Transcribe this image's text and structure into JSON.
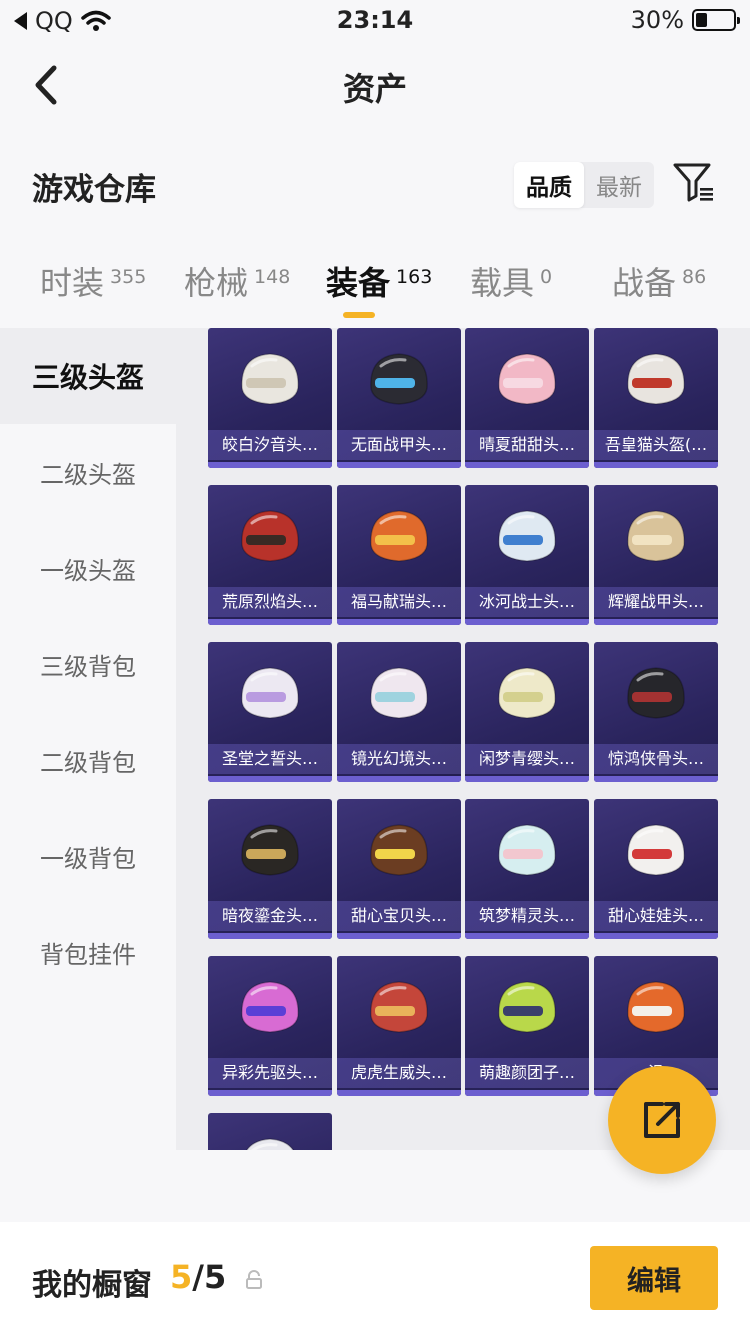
{
  "status_bar": {
    "carrier": "QQ",
    "time": "23:14",
    "battery": "30%",
    "battery_level": 0.3
  },
  "nav": {
    "title": "资产"
  },
  "header": {
    "title": "游戏仓库",
    "sort_options": [
      "品质",
      "最新"
    ],
    "sort_active": "品质"
  },
  "tabs": [
    {
      "label": "时装",
      "count": "355",
      "active": false
    },
    {
      "label": "枪械",
      "count": "148",
      "active": false
    },
    {
      "label": "装备",
      "count": "163",
      "active": true
    },
    {
      "label": "载具",
      "count": "0",
      "active": false
    },
    {
      "label": "战备",
      "count": "86",
      "active": false
    }
  ],
  "sidebar": {
    "items": [
      {
        "label": "三级头盔",
        "active": true
      },
      {
        "label": "二级头盔",
        "active": false
      },
      {
        "label": "一级头盔",
        "active": false
      },
      {
        "label": "三级背包",
        "active": false
      },
      {
        "label": "二级背包",
        "active": false
      },
      {
        "label": "一级背包",
        "active": false
      },
      {
        "label": "背包挂件",
        "active": false
      }
    ]
  },
  "items": [
    {
      "name": "皎白汐音头…",
      "color": "#e9e6df",
      "accent": "#cfc7b5"
    },
    {
      "name": "无面战甲头…",
      "color": "#2b2b33",
      "accent": "#4fb3e8"
    },
    {
      "name": "晴夏甜甜头…",
      "color": "#f2b8c6",
      "accent": "#f7d9e2"
    },
    {
      "name": "吾皇猫头盔(…",
      "color": "#e8e4df",
      "accent": "#c0392b"
    },
    {
      "name": "荒原烈焰头…",
      "color": "#b8322a",
      "accent": "#3a2a24"
    },
    {
      "name": "福马献瑞头…",
      "color": "#e06a2c",
      "accent": "#f3c04a"
    },
    {
      "name": "冰河战士头…",
      "color": "#dfe9f2",
      "accent": "#3f7fcf"
    },
    {
      "name": "辉耀战甲头…",
      "color": "#d9c39a",
      "accent": "#f1e3c2"
    },
    {
      "name": "圣堂之誓头…",
      "color": "#ece8f2",
      "accent": "#b99be0"
    },
    {
      "name": "镜光幻境头…",
      "color": "#efe7ef",
      "accent": "#9fd3df"
    },
    {
      "name": "闲梦青缨头…",
      "color": "#eee9c9",
      "accent": "#d4d08e"
    },
    {
      "name": "惊鸿侠骨头…",
      "color": "#26262b",
      "accent": "#a33232"
    },
    {
      "name": "暗夜鎏金头…",
      "color": "#2a2724",
      "accent": "#caa75a"
    },
    {
      "name": "甜心宝贝头…",
      "color": "#6b3d22",
      "accent": "#f1d54a"
    },
    {
      "name": "筑梦精灵头…",
      "color": "#d6eef0",
      "accent": "#f2c7cf"
    },
    {
      "name": "甜心娃娃头…",
      "color": "#f2f0ee",
      "accent": "#d33a3a"
    },
    {
      "name": "异彩先驱头…",
      "color": "#d86bd3",
      "accent": "#5a3fd6"
    },
    {
      "name": "虎虎生威头…",
      "color": "#c4463a",
      "accent": "#e9b25a"
    },
    {
      "name": "萌趣颜团子…",
      "color": "#b9d84a",
      "accent": "#3b3f6b"
    },
    {
      "name": "滑",
      "color": "#e4692b",
      "accent": "#f3efe9"
    },
    {
      "name": "",
      "color": "#e8e8ee",
      "accent": "#a8a8b8"
    }
  ],
  "bottom": {
    "label": "我的橱窗",
    "count_current": "5",
    "count_sep_total": "/5",
    "edit_label": "编辑"
  },
  "icons": {
    "back": "back-chevron-icon",
    "filter": "filter-funnel-icon",
    "share": "share-export-icon",
    "lock": "lock-icon"
  },
  "colors": {
    "accent": "#f5b325",
    "card": "#2a245d"
  }
}
